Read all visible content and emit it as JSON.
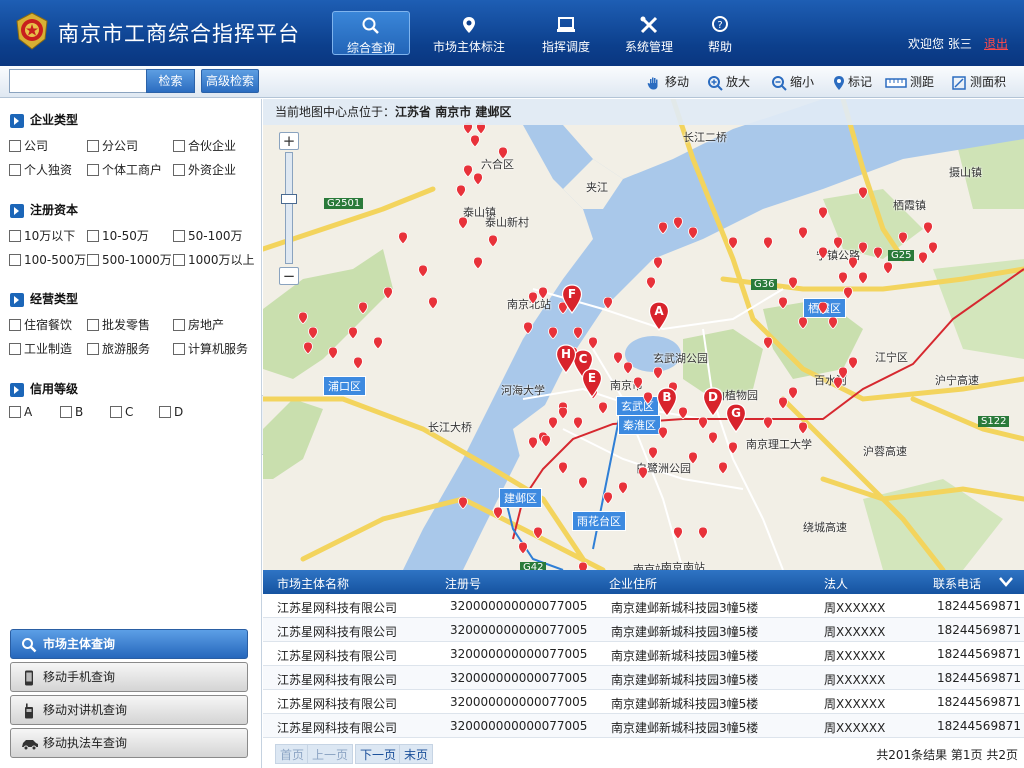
{
  "app": {
    "title": "南京市工商综合指挥平台"
  },
  "colors": {
    "header": "#0c3f8c",
    "accent": "#1c66b8",
    "marker": "#e8323a",
    "logout": "#ff4a4a"
  },
  "nav": [
    {
      "label": "综合查询",
      "icon": "search-icon",
      "active": true
    },
    {
      "label": "市场主体标注",
      "icon": "pin-icon",
      "active": false
    },
    {
      "label": "指挥调度",
      "icon": "monitor-icon",
      "active": false
    },
    {
      "label": "系统管理",
      "icon": "tools-icon",
      "active": false
    },
    {
      "label": "帮助",
      "icon": "help-icon",
      "active": false
    }
  ],
  "user": {
    "welcome": "欢迎您 张三",
    "logout": "退出"
  },
  "search": {
    "value": "",
    "button": "检索",
    "advanced": "高级检索"
  },
  "tools": [
    {
      "label": "移动",
      "icon": "hand-icon"
    },
    {
      "label": "放大",
      "icon": "zoom-in-icon"
    },
    {
      "label": "缩小",
      "icon": "zoom-out-icon"
    },
    {
      "label": "标记",
      "icon": "marker-icon"
    },
    {
      "label": "测距",
      "icon": "ruler-icon"
    },
    {
      "label": "测面积",
      "icon": "area-icon"
    }
  ],
  "filters": [
    {
      "title": "企业类型",
      "options": [
        "公司",
        "分公司",
        "合伙企业",
        "个人独资",
        "个体工商户",
        "外资企业"
      ]
    },
    {
      "title": "注册资本",
      "options": [
        "10万以下",
        "10-50万",
        "50-100万",
        "100-500万",
        "500-1000万",
        "1000万以上"
      ]
    },
    {
      "title": "经营类型",
      "options": [
        "住宿餐饮",
        "批发零售",
        "房地产",
        "工业制造",
        "旅游服务",
        "计算机服务"
      ]
    },
    {
      "title": "信用等级",
      "options": [
        "A",
        "B",
        "C",
        "D"
      ]
    }
  ],
  "side_buttons": [
    {
      "label": "市场主体查询",
      "icon": "search-icon",
      "active": true
    },
    {
      "label": "移动手机查询",
      "icon": "phone-icon",
      "active": false
    },
    {
      "label": "移动对讲机查询",
      "icon": "walkie-talkie-icon",
      "active": false
    },
    {
      "label": "移动执法车查询",
      "icon": "car-icon",
      "active": false
    }
  ],
  "map": {
    "center_label": "当前地图中心点位于：",
    "center": "江苏省  南京市  建邺区",
    "labels": [
      "浦口区",
      "玄武区",
      "秦淮区",
      "建邺区",
      "雨花台区",
      "栖霞区",
      "江宁区",
      "南京市",
      "南京站",
      "南京北站",
      "河海大学",
      "玄武湖公园",
      "中山植物园",
      "南京理工大学",
      "白鹭洲公园",
      "南京南站",
      "泰山镇",
      "摄山镇",
      "栖霞镇",
      "百水河",
      "夹江",
      "六合区",
      "长江大桥",
      "G2501",
      "G36",
      "G25",
      "G42",
      "S122",
      "宁镇公路",
      "沪宁高速",
      "长江二桥",
      "沪蓉高速",
      "绕城高速",
      "泰山新村"
    ],
    "letter_markers": [
      "A",
      "B",
      "C",
      "D",
      "E",
      "F",
      "G",
      "H"
    ]
  },
  "table": {
    "columns": [
      "市场主体名称",
      "注册号",
      "企业住所",
      "法人",
      "联系电话"
    ],
    "rows": [
      [
        "江苏星网科技有限公司",
        "320000000000077005",
        "南京建邺新城科技园3幢5楼",
        "周XXXXXX",
        "18244569871"
      ],
      [
        "江苏星网科技有限公司",
        "320000000000077005",
        "南京建邺新城科技园3幢5楼",
        "周XXXXXX",
        "18244569871"
      ],
      [
        "江苏星网科技有限公司",
        "320000000000077005",
        "南京建邺新城科技园3幢5楼",
        "周XXXXXX",
        "18244569871"
      ],
      [
        "江苏星网科技有限公司",
        "320000000000077005",
        "南京建邺新城科技园3幢5楼",
        "周XXXXXX",
        "18244569871"
      ],
      [
        "江苏星网科技有限公司",
        "320000000000077005",
        "南京建邺新城科技园3幢5楼",
        "周XXXXXX",
        "18244569871"
      ],
      [
        "江苏星网科技有限公司",
        "320000000000077005",
        "南京建邺新城科技园3幢5楼",
        "周XXXXXX",
        "18244569871"
      ]
    ]
  },
  "pager": {
    "first": "首页",
    "prev": "上一页",
    "next": "下一页",
    "last": "末页",
    "info": "共201条结果   第1页 共2页"
  }
}
